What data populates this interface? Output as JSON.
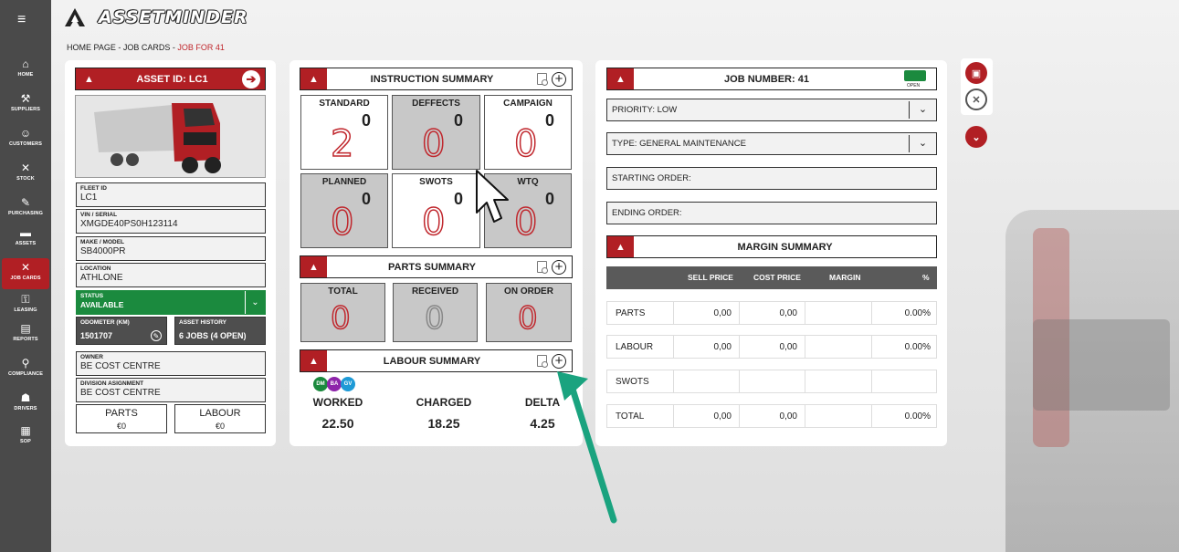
{
  "app": {
    "name": "ASSETMINDER"
  },
  "breadcrumb": {
    "home": "HOME PAGE",
    "sep1": "-",
    "job_cards": "JOB CARDS",
    "sep2": "-",
    "current": "JOB FOR 41"
  },
  "sidebar": {
    "items": [
      {
        "label": "HOME",
        "icon": "home-icon"
      },
      {
        "label": "SUPPLIERS",
        "icon": "suppliers-icon"
      },
      {
        "label": "CUSTOMERS",
        "icon": "customers-icon"
      },
      {
        "label": "STOCK",
        "icon": "stock-icon"
      },
      {
        "label": "PURCHASING",
        "icon": "purchasing-icon"
      },
      {
        "label": "ASSETS",
        "icon": "assets-icon"
      },
      {
        "label": "JOB CARDS",
        "icon": "job-cards-icon",
        "active": true
      },
      {
        "label": "LEASING",
        "icon": "leasing-icon"
      },
      {
        "label": "REPORTS",
        "icon": "reports-icon"
      },
      {
        "label": "COMPLIANCE",
        "icon": "compliance-icon"
      },
      {
        "label": "DRIVERS",
        "icon": "drivers-icon"
      },
      {
        "label": "SOP",
        "icon": "sop-icon"
      }
    ]
  },
  "asset": {
    "title": "ASSET ID: LC1",
    "fleet_id": {
      "label": "FLEET ID",
      "value": "LC1"
    },
    "vin": {
      "label": "VIN / SERIAL",
      "value": "XMGDE40PS0H123114"
    },
    "make_model": {
      "label": "MAKE / MODEL",
      "value": "SB4000PR"
    },
    "location": {
      "label": "LOCATION",
      "value": "ATHLONE"
    },
    "status": {
      "label": "STATUS",
      "value": "AVAILABLE"
    },
    "odometer": {
      "label": "ODOMETER (KM)",
      "value": "1501707"
    },
    "history": {
      "label": "ASSET HISTORY",
      "value": "6 JOBS (4 OPEN)"
    },
    "owner": {
      "label": "OWNER",
      "value": "BE COST CENTRE"
    },
    "division": {
      "label": "DIVISION ASIGNMENT",
      "value": "BE COST CENTRE"
    },
    "parts": {
      "label": "PARTS",
      "value": "€0"
    },
    "labour": {
      "label": "LABOUR",
      "value": "€0"
    }
  },
  "instruction_summary": {
    "title": "INSTRUCTION SUMMARY",
    "tiles": [
      {
        "label": "STANDARD",
        "count": "0",
        "big": "2"
      },
      {
        "label": "DEFFECTS",
        "count": "0",
        "big": "0"
      },
      {
        "label": "CAMPAIGN",
        "count": "0",
        "big": "0"
      },
      {
        "label": "PLANNED",
        "count": "0",
        "big": "0"
      },
      {
        "label": "SWOTS",
        "count": "0",
        "big": "0"
      },
      {
        "label": "WTQ",
        "count": "0",
        "big": "0"
      }
    ]
  },
  "parts_summary": {
    "title": "PARTS SUMMARY",
    "tiles": [
      {
        "label": "TOTAL",
        "big": "0"
      },
      {
        "label": "RECEIVED",
        "big": "0"
      },
      {
        "label": "ON ORDER",
        "big": "0"
      }
    ]
  },
  "labour_summary": {
    "title": "LABOUR SUMMARY",
    "avatars": [
      {
        "initials": "DM",
        "color": "#1b8a3e"
      },
      {
        "initials": "BA",
        "color": "#8e24aa"
      },
      {
        "initials": "GV",
        "color": "#1e9ad6"
      }
    ],
    "worked": {
      "label": "WORKED",
      "value": "22.50"
    },
    "charged": {
      "label": "CHARGED",
      "value": "18.25"
    },
    "delta": {
      "label": "DELTA",
      "value": "4.25"
    }
  },
  "job": {
    "title": "JOB NUMBER: 41",
    "status_badge": "OPEN",
    "priority": "PRIORITY: LOW",
    "type": "TYPE: GENERAL MAINTENANCE",
    "starting_order": "STARTING ORDER:",
    "ending_order": "ENDING ORDER:"
  },
  "margin_summary": {
    "title": "MARGIN SUMMARY",
    "headers": {
      "sell": "SELL PRICE",
      "cost": "COST PRICE",
      "margin": "MARGIN",
      "pct": "%"
    },
    "rows": [
      {
        "name": "PARTS",
        "sell": "0,00",
        "cost": "0,00",
        "margin": "",
        "pct": "0.00%"
      },
      {
        "name": "LABOUR",
        "sell": "0,00",
        "cost": "0,00",
        "margin": "",
        "pct": "0.00%"
      },
      {
        "name": "SWOTS",
        "sell": "",
        "cost": "",
        "margin": "",
        "pct": ""
      },
      {
        "name": "TOTAL",
        "sell": "0,00",
        "cost": "0,00",
        "margin": "",
        "pct": "0.00%"
      }
    ]
  },
  "colors": {
    "brand_red": "#b11f24",
    "sidebar": "#4a4a4a",
    "status_green": "#1b8a3e",
    "annotation_arrow": "#1aa37f"
  }
}
